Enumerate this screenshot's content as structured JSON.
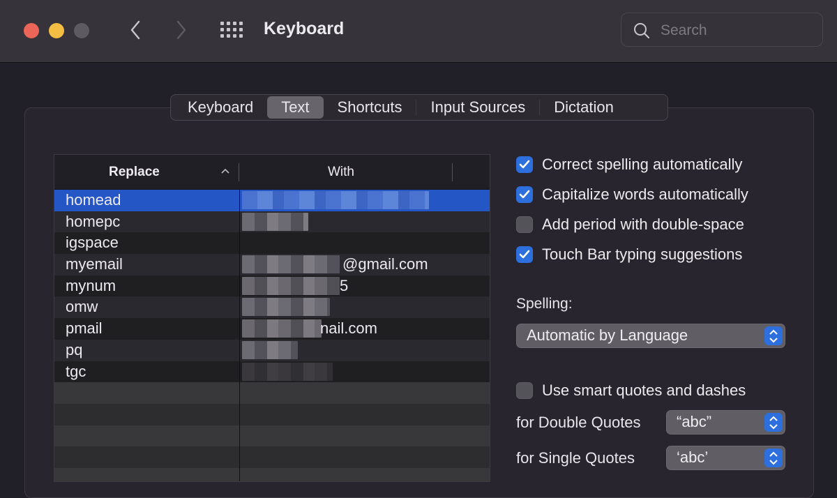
{
  "window": {
    "title": "Keyboard",
    "search_placeholder": "Search",
    "traffic_lights": {
      "close": "#ec6559",
      "minimize": "#f4bd43",
      "zoom": "#5d5b61"
    }
  },
  "tabs": [
    {
      "label": "Keyboard",
      "active": false
    },
    {
      "label": "Text",
      "active": true
    },
    {
      "label": "Shortcuts",
      "active": false
    },
    {
      "label": "Input Sources",
      "active": false
    },
    {
      "label": "Dictation",
      "active": false
    }
  ],
  "table": {
    "columns": {
      "replace": "Replace",
      "with": "With"
    },
    "sort": "ascending",
    "rows": [
      {
        "replace": "homead",
        "with": "[redacted]",
        "with_suffix": "",
        "selected": true
      },
      {
        "replace": "homepc",
        "with": "[redacted]",
        "with_suffix": "",
        "selected": false
      },
      {
        "replace": "igspace",
        "with": "",
        "with_suffix": "",
        "selected": false
      },
      {
        "replace": "myemail",
        "with": "[redacted]",
        "with_suffix": "@gmail.com",
        "selected": false
      },
      {
        "replace": "mynum",
        "with": "[redacted]",
        "with_suffix": "5",
        "selected": false
      },
      {
        "replace": "omw",
        "with": "[redacted]",
        "with_suffix": "",
        "selected": false
      },
      {
        "replace": "pmail",
        "with": "[redacted]",
        "with_suffix": "nail.com",
        "selected": false
      },
      {
        "replace": "pq",
        "with": "[redacted]",
        "with_suffix": "",
        "selected": false
      },
      {
        "replace": "tgc",
        "with": "[redacted]",
        "with_suffix": "",
        "selected": false
      }
    ]
  },
  "options": {
    "correct_spelling": {
      "label": "Correct spelling automatically",
      "checked": true
    },
    "capitalize_words": {
      "label": "Capitalize words automatically",
      "checked": true
    },
    "add_period": {
      "label": "Add period with double-space",
      "checked": false
    },
    "touch_bar": {
      "label": "Touch Bar typing suggestions",
      "checked": true
    },
    "spelling_label": "Spelling:",
    "spelling_value": "Automatic by Language",
    "smart_quotes": {
      "label": "Use smart quotes and dashes",
      "checked": false
    },
    "double_quotes_label": "for Double Quotes",
    "double_quotes_value": "“abc”",
    "single_quotes_label": "for Single Quotes",
    "single_quotes_value": "‘abc’"
  },
  "colors": {
    "accent": "#2e6fde",
    "selection": "#2457c5"
  }
}
